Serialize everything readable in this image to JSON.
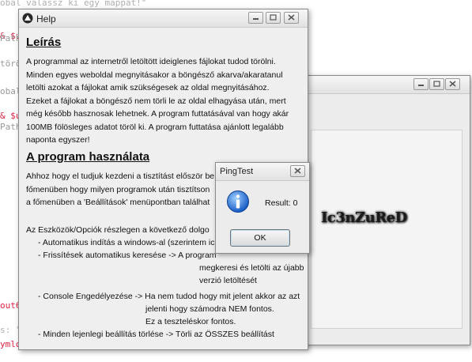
{
  "background_code": {
    "lines": [
      {
        "text": "obal válassz ki egy mappát!\"",
        "kind": "str"
      },
      {
        "text": "& $u",
        "kind": "red"
      },
      {
        "text": "Path",
        "kind": "plain"
      },
      {
        "text": "törö",
        "kind": "plain"
      },
      {
        "text": "obal",
        "kind": "plain"
      },
      {
        "text": "& $u",
        "kind": "red"
      },
      {
        "text": "Path",
        "kind": "plain"
      },
      {
        "text": "out6",
        "kind": "red"
      },
      {
        "text": "s: \"",
        "kind": "str"
      },
      {
        "text": "ymlo",
        "kind": "red"
      }
    ]
  },
  "back_window": {
    "logo_text": "Ic3nZuReD"
  },
  "help_window": {
    "title": "Help",
    "section1_title": "Leírás",
    "section1_lines": [
      "A programmal az internetről letöltött ideiglenes fájlokat tudod törölni.",
      "Minden egyes weboldal megnyitásakor a böngésző akarva/akaratanul",
      "letölti azokat a fájlokat amik szükségesek az oldal megnyitásához.",
      "Ezeket a fájlokat a böngésző nem törli le az oldal elhagyása után, mert",
      "még később hasznosak lehetnek. A program futtatásával van hogy akár",
      "100MB fölösleges adatot töröl ki. A program futtatása ajánlott legalább",
      "naponta egyszer!"
    ],
    "section2_title": "A program használata",
    "section2_lines": [
      "Ahhoz hogy el tudjuk kezdeni a tisztítást először be",
      "főmenüben hogy milyen programok után tisztítson",
      "a főmenüben a 'Beállítások' menüpontban találhat"
    ],
    "intro_line": "Az Eszközök/Opciók részlegen a következő dolgo",
    "options": [
      {
        "label": "- Automatikus indítás a windows-al (szerintem ic"
      },
      {
        "label": "- Frissítések automatikus keresése -> A program"
      },
      {
        "label": "megkeresi és letölti az újabb"
      },
      {
        "label": "verzió letöltését"
      },
      {
        "label": "- Console Engedélyezése -> Ha nem tudod hogy mit jelent akkor az azt"
      },
      {
        "label": "jelenti hogy számodra NEM fontos."
      },
      {
        "label": "Ez a teszteléskor fontos."
      },
      {
        "label": "- Minden lejenlegi beállítás törlése -> Törli az ÖSSZES beállítást"
      }
    ]
  },
  "ping_dialog": {
    "title": "PingTest",
    "result": "Result: 0",
    "ok_label": "OK"
  }
}
